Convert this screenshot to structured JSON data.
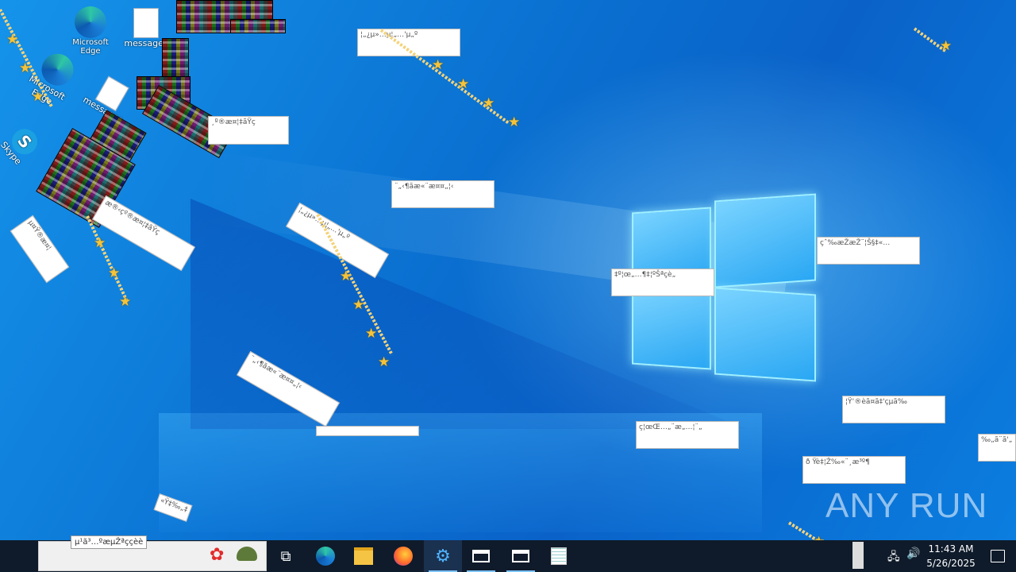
{
  "desktop": {
    "icons": [
      {
        "label": "Microsoft Edge"
      },
      {
        "label": "messages"
      },
      {
        "label": "Microsoft Edge"
      },
      {
        "label": "messages"
      },
      {
        "label": "Skype"
      }
    ],
    "dialogs": [
      "¦„¿µ»…µ¦„…'µ„º",
      "¸º®æ¤¦‡ãŸç",
      "¨„‹¶ãæ«¨æ¤¤„¦‹",
      "¦„¿µ»…µ¦„…'µ„º",
      "æ®‹ç­º®æ¤¦‡ãŸç",
      "çˆ‰æŽæŽ¨¦Š§‡«…",
      "‡º¦œ„…¶‡¦ºŠªçè„",
      "µ¤Ÿ®æ¤¦",
      "¨„‹¶ãæ«¨æ¤¤„¦‹",
      "ç¦œŒ…„¨æ„…¦¨„",
      "¦Ÿ‘®èã¤ã‡'çµã‰",
      "ð Ÿè‡¦Ž‰«¨¸æ³º¶",
      "‰„ã¨ã'„",
      "«Ÿ‡‰„‡",
      "µ¹ã³…ºæµŽªççèè"
    ],
    "watermark": "ANY RUN"
  },
  "taskbar": {
    "search_text": "µ¹ã³…ºæµŽªççèè",
    "apps": [
      {
        "name": "task-view"
      },
      {
        "name": "edge"
      },
      {
        "name": "file-explorer"
      },
      {
        "name": "firefox"
      },
      {
        "name": "settings"
      },
      {
        "name": "window-1"
      },
      {
        "name": "window-2"
      },
      {
        "name": "notepad"
      }
    ],
    "clock_time": "11:43 AM",
    "clock_date": "5/26/2025"
  },
  "colors": {
    "accent": "#0a78d8",
    "taskbar": "#0f1b2a",
    "star": "#f5c33b"
  }
}
